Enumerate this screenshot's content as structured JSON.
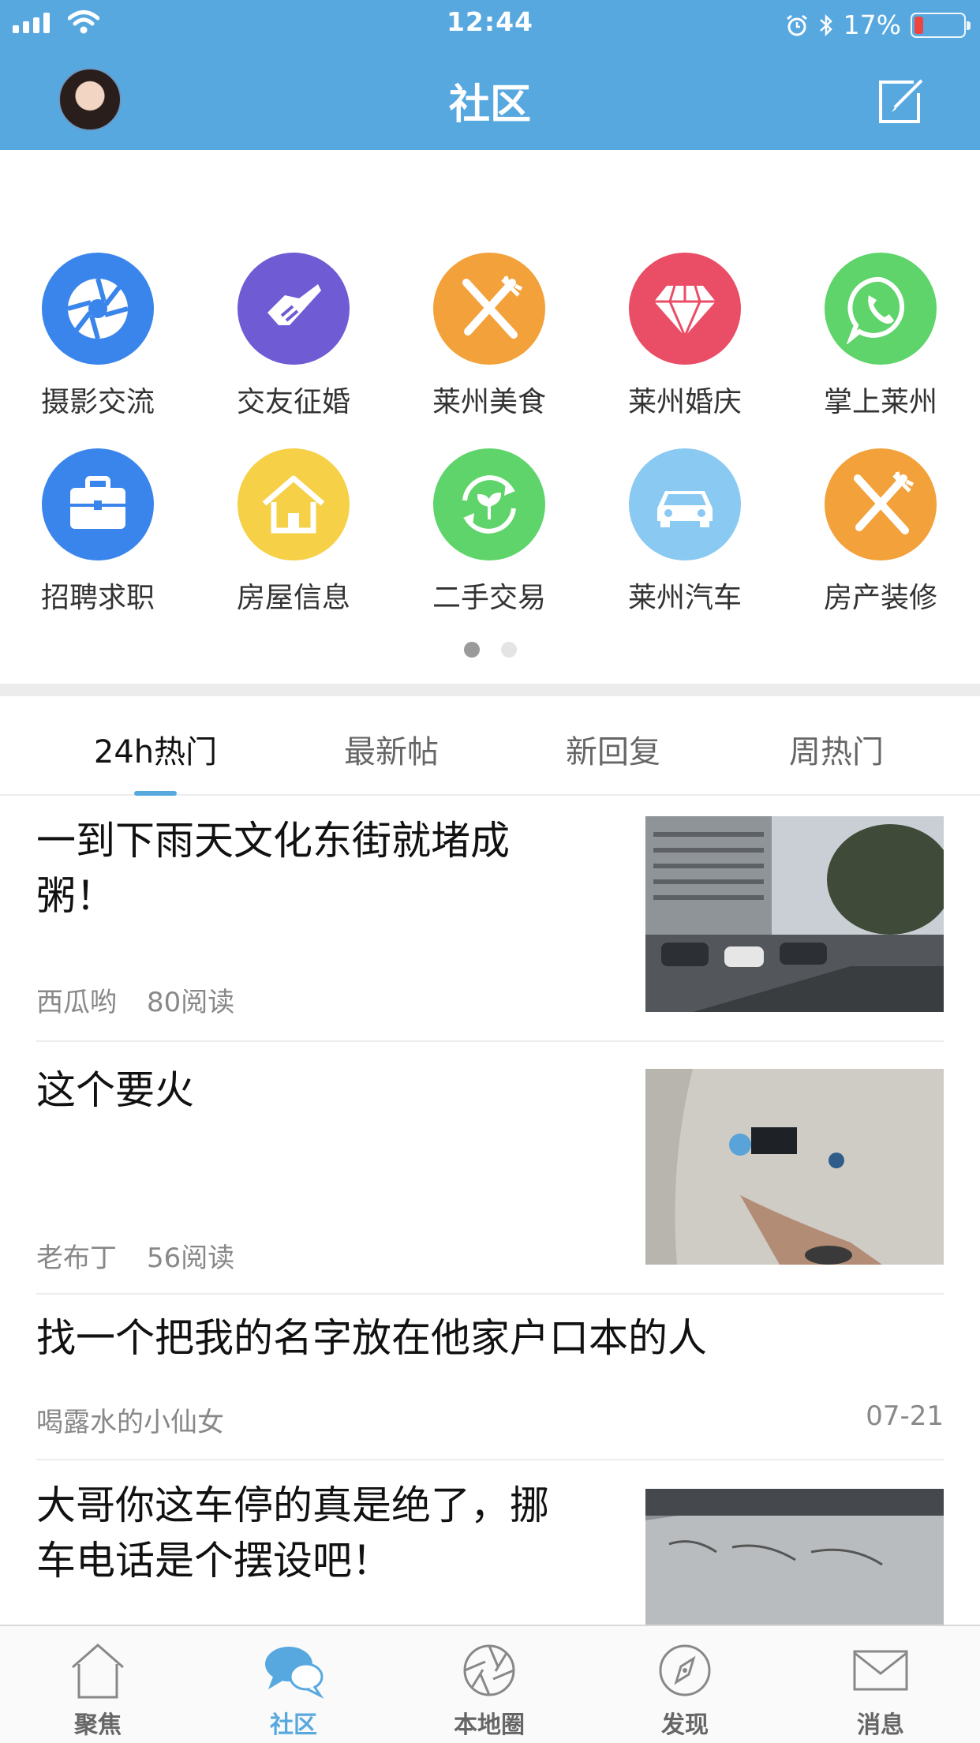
{
  "status_bar": {
    "time": "12:44",
    "battery_percent": "17%",
    "battery_level": 0.17
  },
  "header": {
    "title": "社区"
  },
  "categories": [
    {
      "label": "摄影交流",
      "icon": "camera-aperture-icon",
      "color": "#3a85ec"
    },
    {
      "label": "交友征婚",
      "icon": "handshake-icon",
      "color": "#6f5bd4"
    },
    {
      "label": "莱州美食",
      "icon": "fork-knife-icon",
      "color": "#f3a13a"
    },
    {
      "label": "莱州婚庆",
      "icon": "diamond-icon",
      "color": "#ea4d66"
    },
    {
      "label": "掌上莱州",
      "icon": "whatsapp-phone-icon",
      "color": "#5ed46a"
    },
    {
      "label": "招聘求职",
      "icon": "briefcase-icon",
      "color": "#3a85ec"
    },
    {
      "label": "房屋信息",
      "icon": "house-icon",
      "color": "#f6d046"
    },
    {
      "label": "二手交易",
      "icon": "recycle-leaf-icon",
      "color": "#5ed46a"
    },
    {
      "label": "莱州汽车",
      "icon": "car-icon",
      "color": "#89c9f2"
    },
    {
      "label": "房产装修",
      "icon": "fork-knife-icon",
      "color": "#f3a13a"
    }
  ],
  "pager": {
    "pages": 2,
    "current": 1
  },
  "tabs": [
    {
      "label": "24h热门"
    },
    {
      "label": "最新帖"
    },
    {
      "label": "新回复"
    },
    {
      "label": "周热门"
    }
  ],
  "posts": [
    {
      "title_line1": "一到下雨天文化东街就堵成",
      "title_line2": "粥！",
      "author": "西瓜哟",
      "reads": "80阅读"
    },
    {
      "title_line1": "这个要火",
      "author": "老布丁",
      "reads": "56阅读"
    },
    {
      "title_line1": "找一个把我的名字放在他家户口本的人",
      "author": "喝露水的小仙女",
      "date": "07-21"
    },
    {
      "title_line1": "大哥你这车停的真是绝了，挪",
      "title_line2": "车电话是个摆设吧！"
    }
  ],
  "tab_bar": [
    {
      "label": "聚焦",
      "icon": "home-icon"
    },
    {
      "label": "社区",
      "icon": "chat-bubbles-icon"
    },
    {
      "label": "本地圈",
      "icon": "aperture-icon"
    },
    {
      "label": "发现",
      "icon": "compass-icon"
    },
    {
      "label": "消息",
      "icon": "envelope-icon"
    }
  ]
}
